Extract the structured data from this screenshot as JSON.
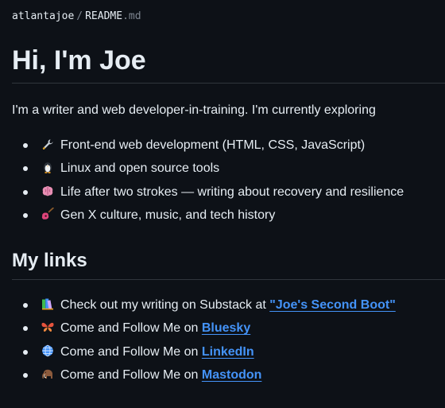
{
  "breadcrumb": {
    "owner": "atlantajoe",
    "separator": "/",
    "file_name": "README",
    "file_ext": ".md"
  },
  "heading": "Hi, I'm Joe",
  "intro": "I'm a writer and web developer-in-training. I'm currently exploring",
  "exploring": [
    {
      "icon": "wrench-icon",
      "text": "Front-end web development (HTML, CSS, JavaScript)"
    },
    {
      "icon": "penguin-icon",
      "text": "Linux and open source tools"
    },
    {
      "icon": "brain-icon",
      "text": "Life after two strokes — writing about recovery and resilience"
    },
    {
      "icon": "guitar-icon",
      "text": "Gen X culture, music, and tech history"
    }
  ],
  "links_heading": "My links",
  "links": [
    {
      "icon": "books-icon",
      "prefix": "Check out my writing on Substack at ",
      "link": "\"Joe's Second Boot\""
    },
    {
      "icon": "butterfly-icon",
      "prefix": "Come and Follow Me on ",
      "link": "Bluesky"
    },
    {
      "icon": "globe-icon",
      "prefix": "Come and Follow Me on ",
      "link": "LinkedIn"
    },
    {
      "icon": "mammoth-icon",
      "prefix": "Come and Follow Me on ",
      "link": "Mastodon"
    }
  ],
  "colors": {
    "background": "#0d1117",
    "text": "#e6edf3",
    "muted": "#7d8590",
    "link": "#4493f8",
    "border": "#30363d"
  }
}
